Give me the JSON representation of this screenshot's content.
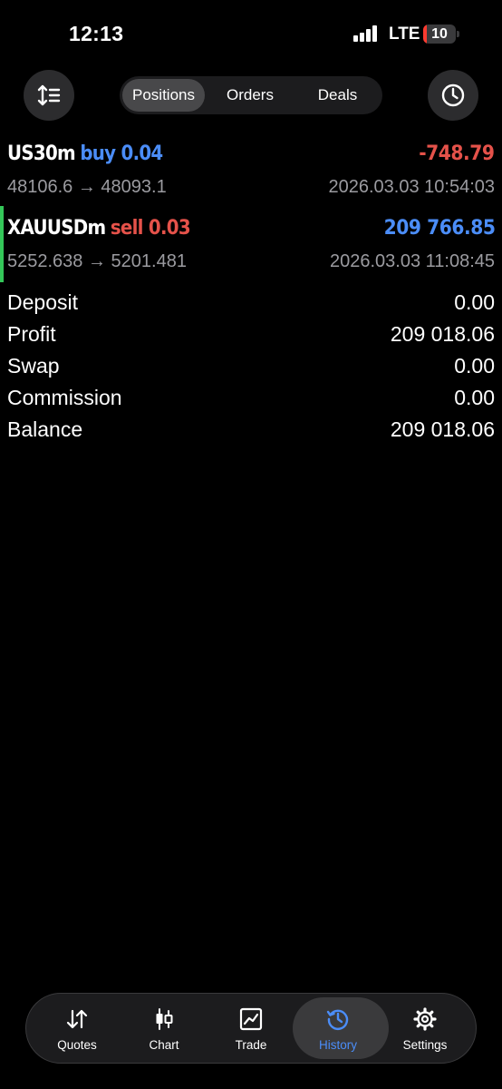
{
  "status_bar": {
    "time": "12:13",
    "carrier": "LTE",
    "battery": "10",
    "battery_level": 0.1
  },
  "toolbar": {
    "sort_icon": "sort-arrows-icon",
    "clock_icon": "clock-icon",
    "tabs": [
      {
        "label": "Positions",
        "active": true
      },
      {
        "label": "Orders",
        "active": false
      },
      {
        "label": "Deals",
        "active": false
      }
    ]
  },
  "positions": [
    {
      "symbol": "US30m",
      "side": "buy 0.04",
      "side_color": "#4b8df8",
      "profit": "-748.79",
      "profit_color": "#e5524a",
      "open_price": "48106.6",
      "arrow": "→",
      "close_price": "48093.1",
      "datetime": "2026.03.03 10:54:03"
    },
    {
      "symbol": "XAUUSDm",
      "side": "sell 0.03",
      "side_color": "#e5524a",
      "profit": "209 766.85",
      "profit_color": "#4b8df8",
      "open_price": "5252.638",
      "arrow": "→",
      "close_price": "5201.481",
      "datetime": "2026.03.03 11:08:45"
    }
  ],
  "summary": [
    {
      "label": "Deposit",
      "value": "0.00"
    },
    {
      "label": "Profit",
      "value": "209 018.06"
    },
    {
      "label": "Swap",
      "value": "0.00"
    },
    {
      "label": "Commission",
      "value": "0.00"
    },
    {
      "label": "Balance",
      "value": "209 018.06"
    }
  ],
  "nav": {
    "items": [
      {
        "label": "Quotes",
        "icon": "quotes-arrows-icon"
      },
      {
        "label": "Chart",
        "icon": "candlestick-chart-icon"
      },
      {
        "label": "Trade",
        "icon": "trade-chart-icon"
      },
      {
        "label": "History",
        "icon": "history-clock-icon",
        "active": true
      },
      {
        "label": "Settings",
        "icon": "gear-icon"
      }
    ],
    "active_color": "#4b8df8"
  }
}
